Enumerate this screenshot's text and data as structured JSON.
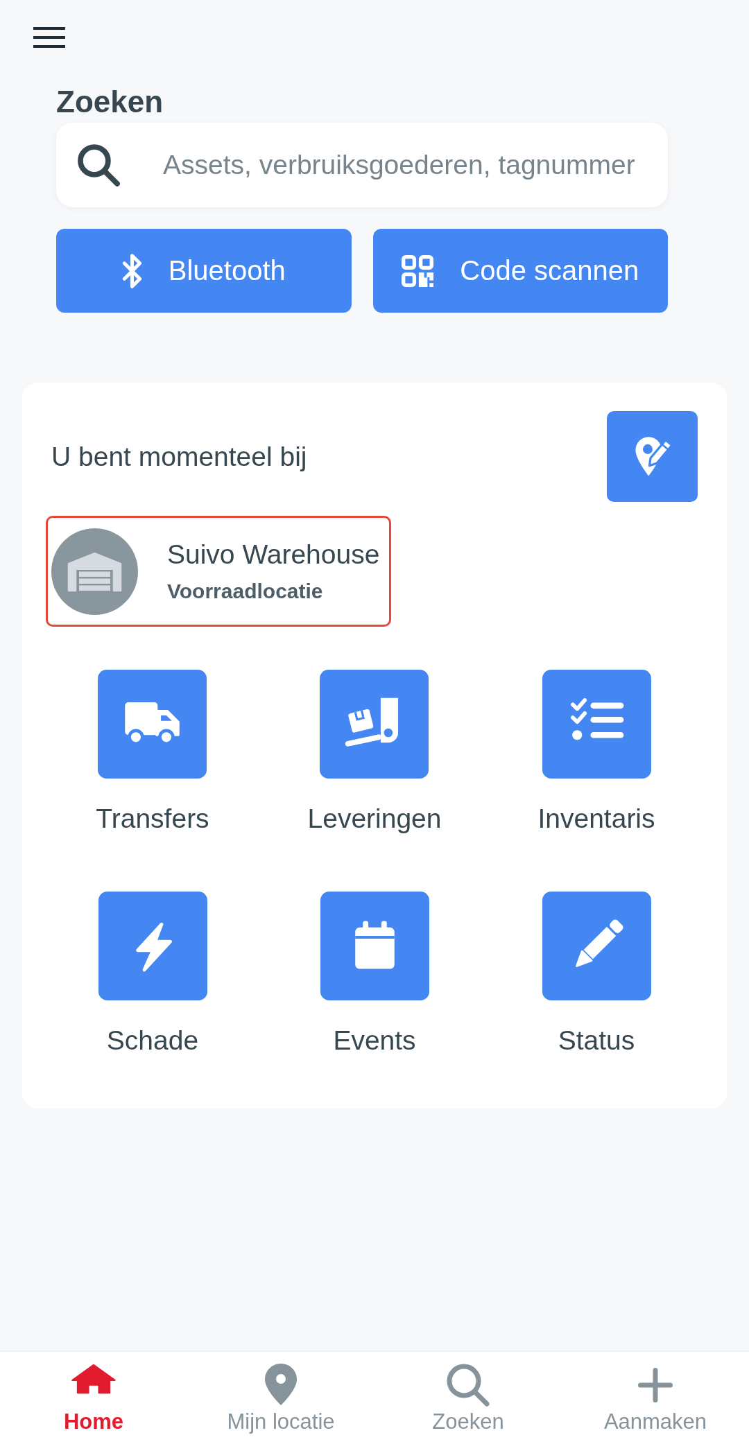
{
  "search": {
    "title": "Zoeken",
    "placeholder": "Assets, verbruiksgoederen, tagnummer"
  },
  "scan_buttons": [
    {
      "label": "Bluetooth"
    },
    {
      "label": "Code scannen"
    }
  ],
  "current_location": {
    "heading": "U bent momenteel bij",
    "name": "Suivo Warehouse",
    "type": "Voorraadlocatie",
    "highlighted": true
  },
  "actions": [
    {
      "label": "Transfers"
    },
    {
      "label": "Leveringen"
    },
    {
      "label": "Inventaris"
    },
    {
      "label": "Schade"
    },
    {
      "label": "Events"
    },
    {
      "label": "Status"
    }
  ],
  "bottom_nav": [
    {
      "label": "Home",
      "selected": true
    },
    {
      "label": "Mijn locatie",
      "selected": false
    },
    {
      "label": "Zoeken",
      "selected": false
    },
    {
      "label": "Aanmaken",
      "selected": false
    }
  ]
}
